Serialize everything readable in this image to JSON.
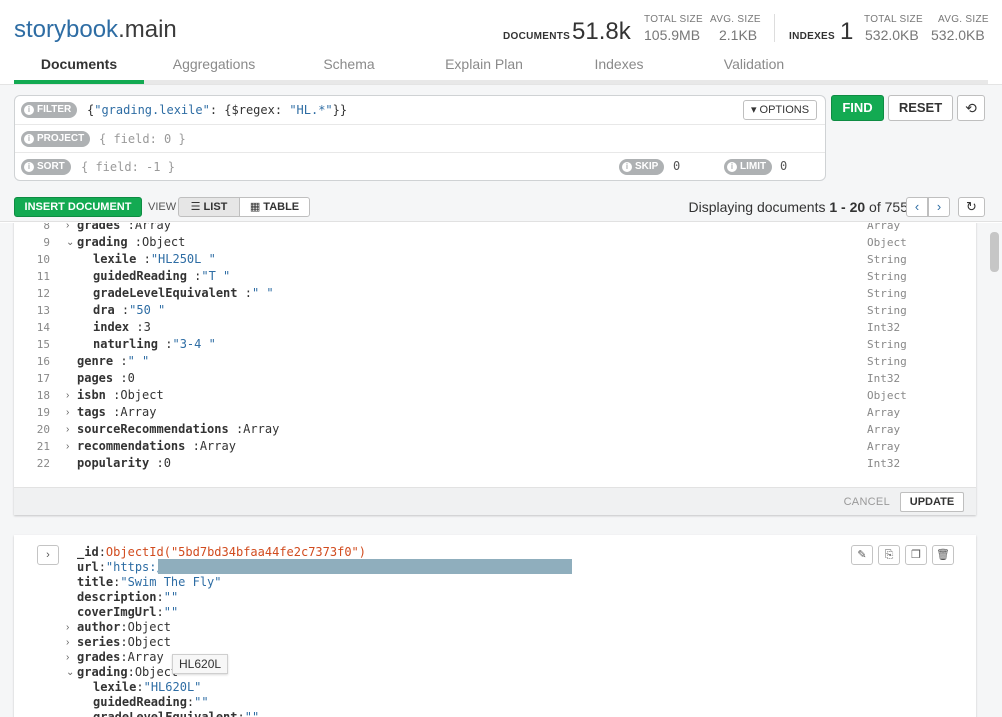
{
  "header": {
    "db": "storybook",
    "collection": ".main",
    "documents_label": "DOCUMENTS",
    "documents_count": "51.8k",
    "doc_total_size_label": "TOTAL SIZE",
    "doc_total_size": "105.9MB",
    "doc_avg_size_label": "AVG. SIZE",
    "doc_avg_size": "2.1KB",
    "indexes_label": "INDEXES",
    "indexes_count": "1",
    "idx_total_size_label": "TOTAL SIZE",
    "idx_total_size": "532.0KB",
    "idx_avg_size_label": "AVG. SIZE",
    "idx_avg_size": "532.0KB"
  },
  "tabs": [
    "Documents",
    "Aggregations",
    "Schema",
    "Explain Plan",
    "Indexes",
    "Validation"
  ],
  "query": {
    "filter_label": "FILTER",
    "filter_prefix": "{",
    "filter_key": "\"grading.lexile\"",
    "filter_mid": ": {$regex: ",
    "filter_value": "\"HL.*\"",
    "filter_suffix": "}}",
    "options_label": "OPTIONS",
    "project_label": "PROJECT",
    "project_placeholder": "{ field: 0 }",
    "sort_label": "SORT",
    "sort_placeholder": "{ field: -1 }",
    "skip_label": "SKIP",
    "skip_value": "0",
    "limit_label": "LIMIT",
    "limit_value": "0",
    "find_label": "FIND",
    "reset_label": "RESET"
  },
  "toolbar": {
    "insert_label": "INSERT DOCUMENT",
    "view_label": "VIEW",
    "list_label": "LIST",
    "table_label": "TABLE",
    "displaying_prefix": "Displaying documents ",
    "range": "1 - 20",
    "of_text": " of ",
    "total": "755"
  },
  "doc1": {
    "lines": [
      {
        "n": "8",
        "key": "grades",
        "val": "Array",
        "type": "Array",
        "caret": "right",
        "indent": 0,
        "cls": "fval"
      },
      {
        "n": "9",
        "key": "grading",
        "val": "Object",
        "type": "Object",
        "caret": "down",
        "indent": 0,
        "cls": "fval"
      },
      {
        "n": "10",
        "key": "lexile",
        "val": "\"HL250L \"",
        "type": "String",
        "caret": "",
        "indent": 1,
        "cls": "fstr"
      },
      {
        "n": "11",
        "key": "guidedReading",
        "val": "\"T \"",
        "type": "String",
        "caret": "",
        "indent": 1,
        "cls": "fstr"
      },
      {
        "n": "12",
        "key": "gradeLevelEquivalent",
        "val": "\"  \"",
        "type": "String",
        "caret": "",
        "indent": 1,
        "cls": "fstr"
      },
      {
        "n": "13",
        "key": "dra",
        "val": "\"50 \"",
        "type": "String",
        "caret": "",
        "indent": 1,
        "cls": "fstr"
      },
      {
        "n": "14",
        "key": "index",
        "val": "3",
        "type": "Int32",
        "caret": "",
        "indent": 1,
        "cls": "fval"
      },
      {
        "n": "15",
        "key": "naturling",
        "val": "\"3-4 \"",
        "type": "String",
        "caret": "",
        "indent": 1,
        "cls": "fstr"
      },
      {
        "n": "16",
        "key": "genre",
        "val": "\"  \"",
        "type": "String",
        "caret": "",
        "indent": 0,
        "cls": "fstr"
      },
      {
        "n": "17",
        "key": "pages",
        "val": "0",
        "type": "Int32",
        "caret": "",
        "indent": 0,
        "cls": "fval"
      },
      {
        "n": "18",
        "key": "isbn",
        "val": "Object",
        "type": "Object",
        "caret": "right",
        "indent": 0,
        "cls": "fval"
      },
      {
        "n": "19",
        "key": "tags",
        "val": "Array",
        "type": "Array",
        "caret": "right",
        "indent": 0,
        "cls": "fval"
      },
      {
        "n": "20",
        "key": "sourceRecommendations",
        "val": "Array",
        "type": "Array",
        "caret": "right",
        "indent": 0,
        "cls": "fval"
      },
      {
        "n": "21",
        "key": "recommendations",
        "val": "Array",
        "type": "Array",
        "caret": "right",
        "indent": 0,
        "cls": "fval"
      },
      {
        "n": "22",
        "key": "popularity",
        "val": "0",
        "type": "Int32",
        "caret": "",
        "indent": 0,
        "cls": "fval"
      }
    ],
    "cancel_label": "CANCEL",
    "update_label": "UPDATE"
  },
  "doc2": {
    "lines": [
      {
        "key": "_id",
        "val": "ObjectId(\"5bd7bd34bfaa44fe2c7373f0\")",
        "cls": "foid",
        "caret": "",
        "indent": 0
      },
      {
        "key": "url",
        "val": "\"https:/",
        "cls": "fstr",
        "caret": "",
        "indent": 0
      },
      {
        "key": "title",
        "val": "\"Swim The Fly\"",
        "cls": "fstr",
        "caret": "",
        "indent": 0
      },
      {
        "key": "description",
        "val": "\"\"",
        "cls": "fstr",
        "caret": "",
        "indent": 0
      },
      {
        "key": "coverImgUrl",
        "val": "\"\"",
        "cls": "fstr",
        "caret": "",
        "indent": 0
      },
      {
        "key": "author",
        "val": "Object",
        "cls": "fval",
        "caret": "right",
        "indent": 0
      },
      {
        "key": "series",
        "val": "Object",
        "cls": "fval",
        "caret": "right",
        "indent": 0
      },
      {
        "key": "grades",
        "val": "Array",
        "cls": "fval",
        "caret": "right",
        "indent": 0
      },
      {
        "key": "grading",
        "val": "Object",
        "cls": "fval",
        "caret": "down",
        "indent": 0
      },
      {
        "key": "lexile",
        "val": "\"HL620L\"",
        "cls": "fstr",
        "caret": "",
        "indent": 1
      },
      {
        "key": "guidedReading",
        "val": "\"\"",
        "cls": "fstr",
        "caret": "",
        "indent": 1
      },
      {
        "key": "gradeLevelEquivalent",
        "val": "\"\"",
        "cls": "fstr",
        "caret": "",
        "indent": 1
      }
    ],
    "tooltip": "HL620L"
  },
  "icons": {
    "info": "i",
    "caret_down": "▾",
    "history": "⟲",
    "list": "☰",
    "table": "▦",
    "prev": "‹",
    "next": "›",
    "refresh": "↻",
    "expand": "›",
    "edit": "✎",
    "copy": "⎘",
    "clone": "❐",
    "delete": "🗑"
  }
}
